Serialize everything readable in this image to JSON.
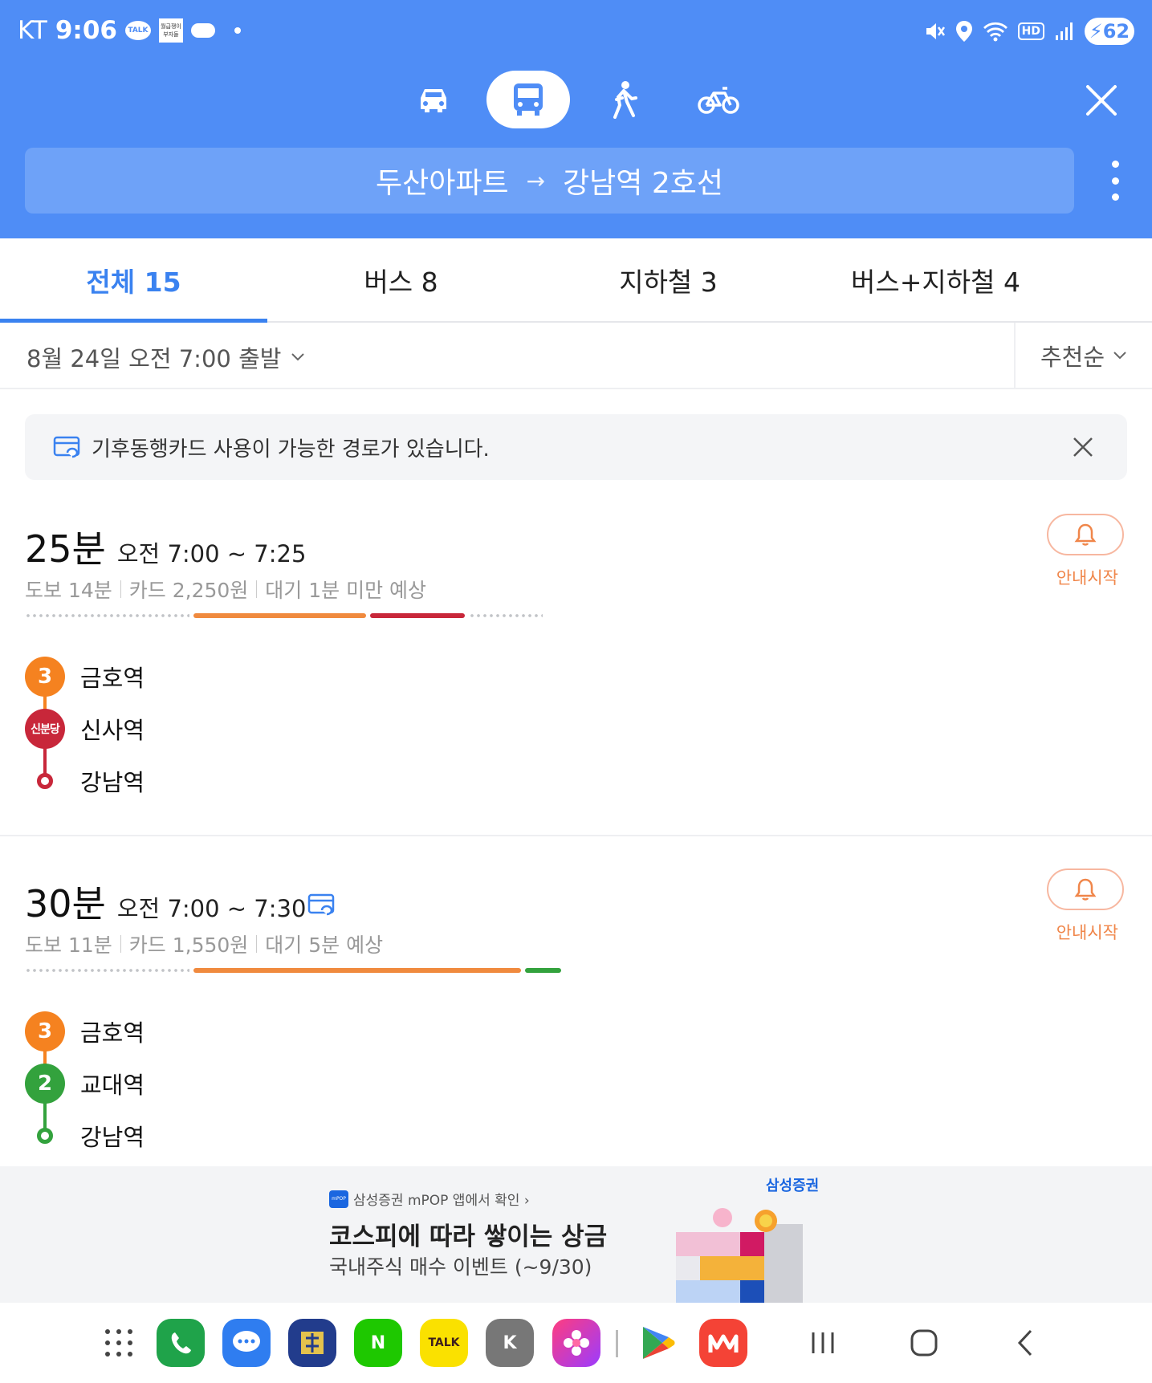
{
  "status_bar": {
    "carrier": "KT",
    "time": "9:06",
    "talk_badge": "TALK",
    "news_badge": "월급쟁이 부자들",
    "hd_label": "HD",
    "battery": "62"
  },
  "transport_modes": [
    {
      "icon": "car-icon",
      "active": false
    },
    {
      "icon": "bus-icon",
      "active": true
    },
    {
      "icon": "walk-icon",
      "active": false
    },
    {
      "icon": "bicycle-icon",
      "active": false
    }
  ],
  "route": {
    "origin": "두산아파트",
    "arrow": "→",
    "destination": "강남역 2호선"
  },
  "tabs": [
    {
      "label": "전체 15",
      "active": true
    },
    {
      "label": "버스 8",
      "active": false
    },
    {
      "label": "지하철 3",
      "active": false
    },
    {
      "label": "버스+지하철 4",
      "active": false
    }
  ],
  "filter": {
    "departure": "8월 24일 오전 7:00 출발",
    "sort": "추천순"
  },
  "notice": {
    "text": "기후동행카드 사용이 가능한 경로가 있습니다."
  },
  "results": [
    {
      "duration": "25분",
      "time_range": "오전 7:00 ~ 7:25",
      "walk": "도보 14분",
      "fare": "카드 2,250원",
      "wait": "대기 1분 미만 예상",
      "guide_label": "안내시작",
      "stops": [
        {
          "badge": "3",
          "name": "금호역",
          "color": "#f58220"
        },
        {
          "badge": "신분당",
          "name": "신사역",
          "color": "#c8273a"
        },
        {
          "badge": "",
          "name": "강남역",
          "color": "#c8273a"
        }
      ],
      "bar_colors": [
        "#f08a3e",
        "#c8273a"
      ]
    },
    {
      "duration": "30분",
      "time_range": "오전 7:00 ~ 7:30",
      "walk": "도보 11분",
      "fare": "카드 1,550원",
      "wait": "대기 5분 예상",
      "guide_label": "안내시작",
      "stops": [
        {
          "badge": "3",
          "name": "금호역",
          "color": "#f58220"
        },
        {
          "badge": "2",
          "name": "교대역",
          "color": "#33a23d"
        },
        {
          "badge": "",
          "name": "강남역",
          "color": "#33a23d"
        }
      ],
      "bar_colors": [
        "#f08a3e",
        "#33a23d"
      ]
    }
  ],
  "ad": {
    "source": "삼성증권 mPOP 앱에서 확인 ›",
    "logo_text": "mPOP",
    "title": "코스피에 따라 쌓이는 상금",
    "subtitle": "국내주식 매수 이벤트 (~9/30)",
    "brand": "삼성증권"
  },
  "dock": {
    "apps": [
      "apps-grid-icon",
      "phone-icon",
      "messages-icon",
      "bank-icon",
      "naver-icon",
      "kakaotalk-icon",
      "kakao-k-icon",
      "gallery-icon",
      "play-store-icon",
      "m-app-icon"
    ],
    "naver_label": "N",
    "talk_label": "TALK",
    "k_label": "K"
  },
  "accent_colors": {
    "header": "#4f8df6",
    "tab_active": "#3a82f0",
    "guide": "#f0864a"
  }
}
